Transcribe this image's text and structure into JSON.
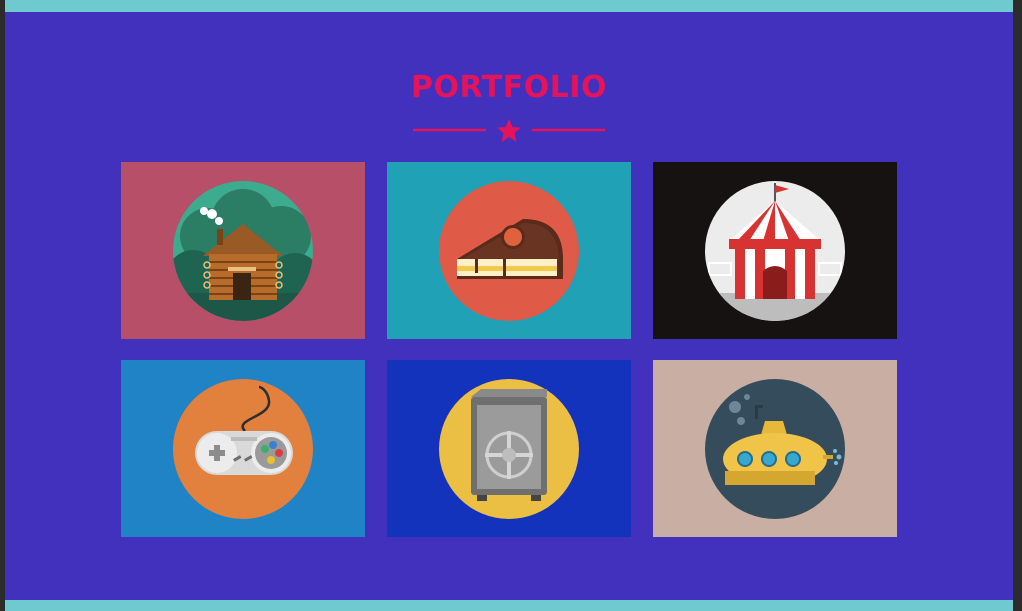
{
  "section": {
    "title": "PORTFOLIO"
  },
  "colors": {
    "page_bg": "#4131bd",
    "accent": "#e3135c",
    "top_bar": "#6ecacf"
  },
  "portfolio": {
    "items": [
      {
        "icon": "log-cabin-icon",
        "tile_color": "#b84f68",
        "circle_color": "#3dab8e"
      },
      {
        "icon": "cake-slice-icon",
        "tile_color": "#20a1b5",
        "circle_color": "#e05a48"
      },
      {
        "icon": "circus-tent-icon",
        "tile_color": "#161212",
        "circle_color": "#ececec"
      },
      {
        "icon": "game-controller-icon",
        "tile_color": "#1f83c6",
        "circle_color": "#e2803e"
      },
      {
        "icon": "safe-vault-icon",
        "tile_color": "#1333bd",
        "circle_color": "#ebbf44"
      },
      {
        "icon": "submarine-icon",
        "tile_color": "#c9aea3",
        "circle_color": "#354c5c"
      }
    ]
  }
}
